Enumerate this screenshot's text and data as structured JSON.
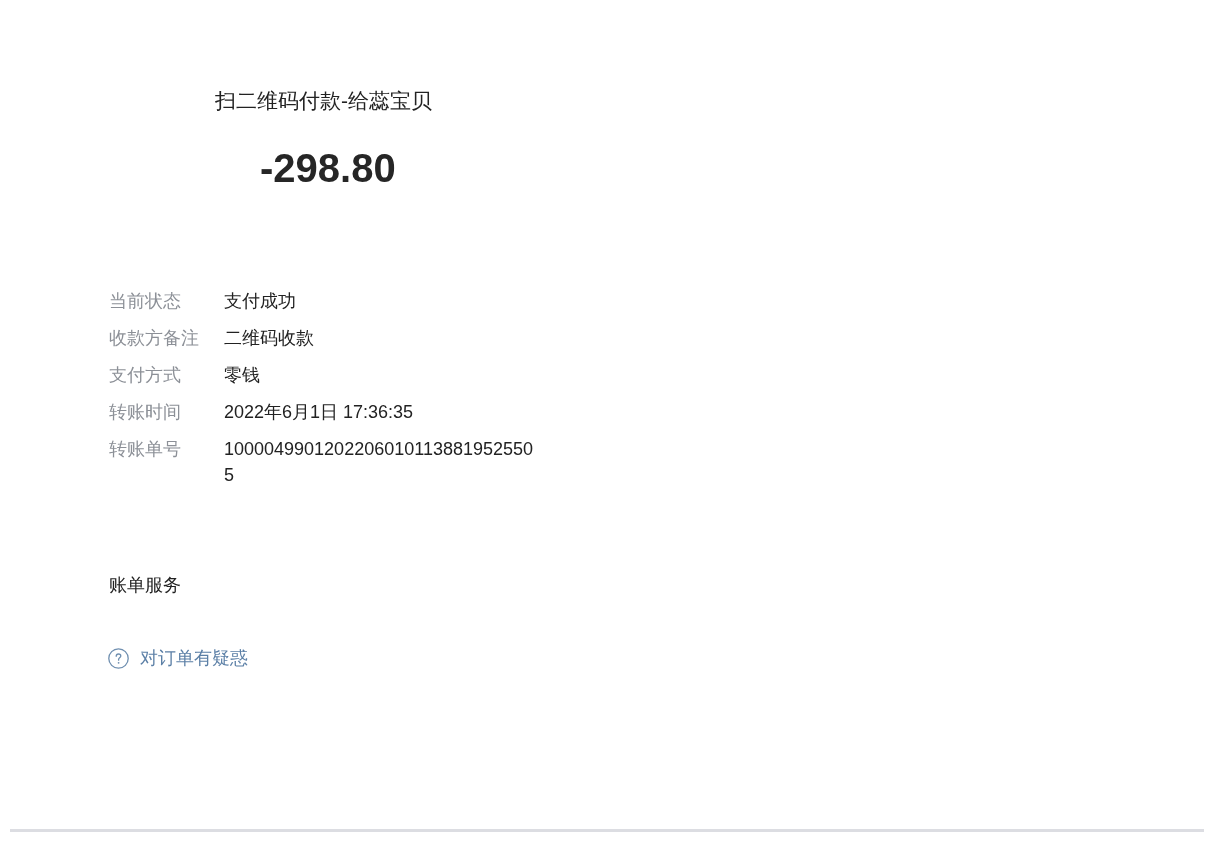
{
  "header": {
    "title": "扫二维码付款-给蕊宝贝",
    "amount": "-298.80"
  },
  "details": [
    {
      "label": "当前状态",
      "value": "支付成功"
    },
    {
      "label": "收款方备注",
      "value": "二维码收款"
    },
    {
      "label": "支付方式",
      "value": "零钱"
    },
    {
      "label": "转账时间",
      "value": "2022年6月1日 17:36:35"
    },
    {
      "label": "转账单号",
      "value": "10000499012022060101138819525505"
    }
  ],
  "services": {
    "title": "账单服务",
    "links": [
      {
        "label": "对订单有疑惑"
      }
    ]
  }
}
